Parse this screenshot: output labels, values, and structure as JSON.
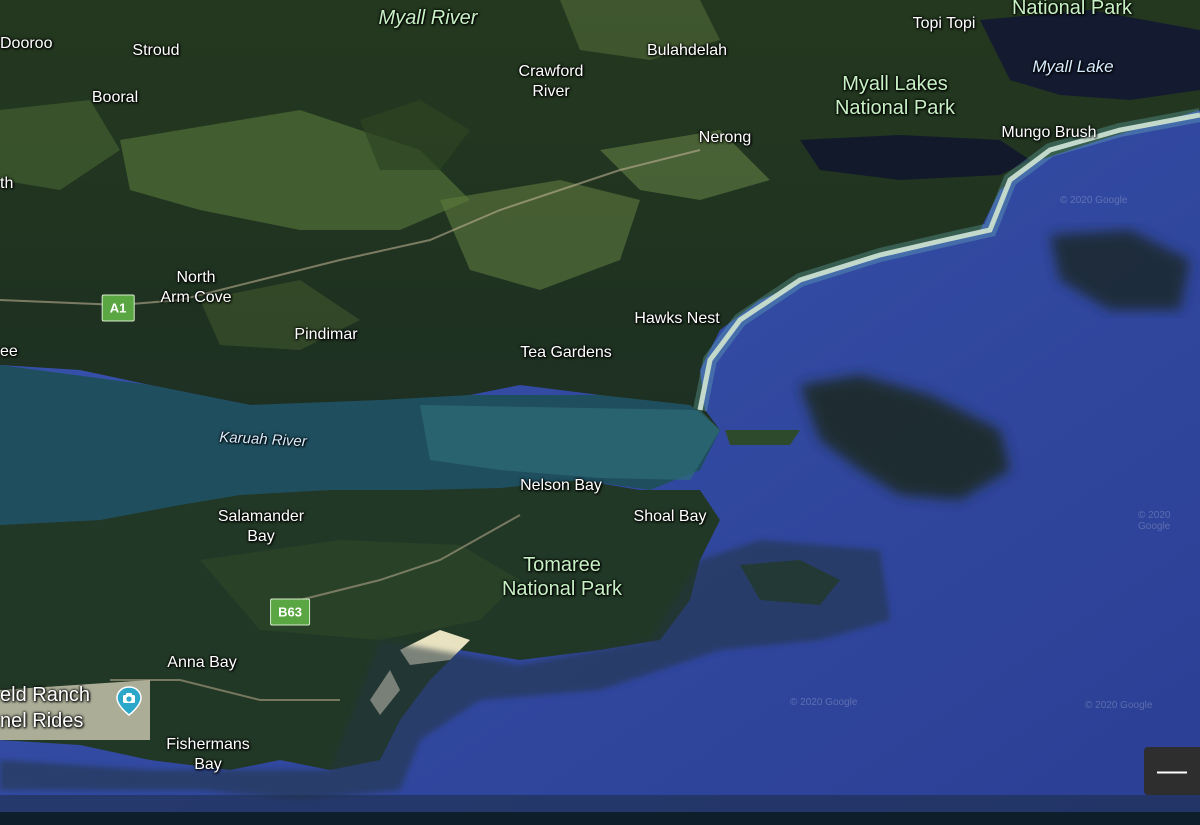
{
  "map": {
    "view": "satellite-3d",
    "colors": {
      "ocean": "#3a56b3",
      "deep_ocean": "#2a3f95",
      "land_forest": "#1f3a22",
      "land_farm": "#5f7a3e",
      "beach": "#e6e2cf",
      "estuary": "#2a5a66"
    },
    "labels": {
      "doorooo": "Dooroo",
      "stroud": "Stroud",
      "booral": "Booral",
      "myall_river": "Myall River",
      "crawford_river": "Crawford\nRiver",
      "bulahdelah": "Bulahdelah",
      "topi_topi": "Topi Topi",
      "national_park_top": "National Park",
      "myall_lake": "Myall Lake",
      "myall_lakes_np": "Myall Lakes\nNational Park",
      "nerong": "Nerong",
      "mungo_brush": "Mungo Brush",
      "th": "th",
      "north_arm_cove": "North\nArm Cove",
      "ee": "ee",
      "pindimar": "Pindimar",
      "hawks_nest": "Hawks Nest",
      "tea_gardens": "Tea Gardens",
      "karuah_river": "Karuah River",
      "nelson_bay": "Nelson Bay",
      "shoal_bay": "Shoal Bay",
      "salamander_bay": "Salamander\nBay",
      "tomaree_np": "Tomaree\nNational Park",
      "anna_bay": "Anna Bay",
      "eld_ranch": "eld Ranch",
      "nel_rides": "nel Rides",
      "fishermans_bay": "Fishermans\nBay"
    },
    "shields": {
      "a1": "A1",
      "b63": "B63"
    },
    "copyright": {
      "c1": "© 2020 Google",
      "c2": "© 2020 Google",
      "c3": "© 2020 Google",
      "c4": "© 2020 Google"
    },
    "pin_icon": "camera-pin-icon",
    "zoom_out_label": "—"
  }
}
